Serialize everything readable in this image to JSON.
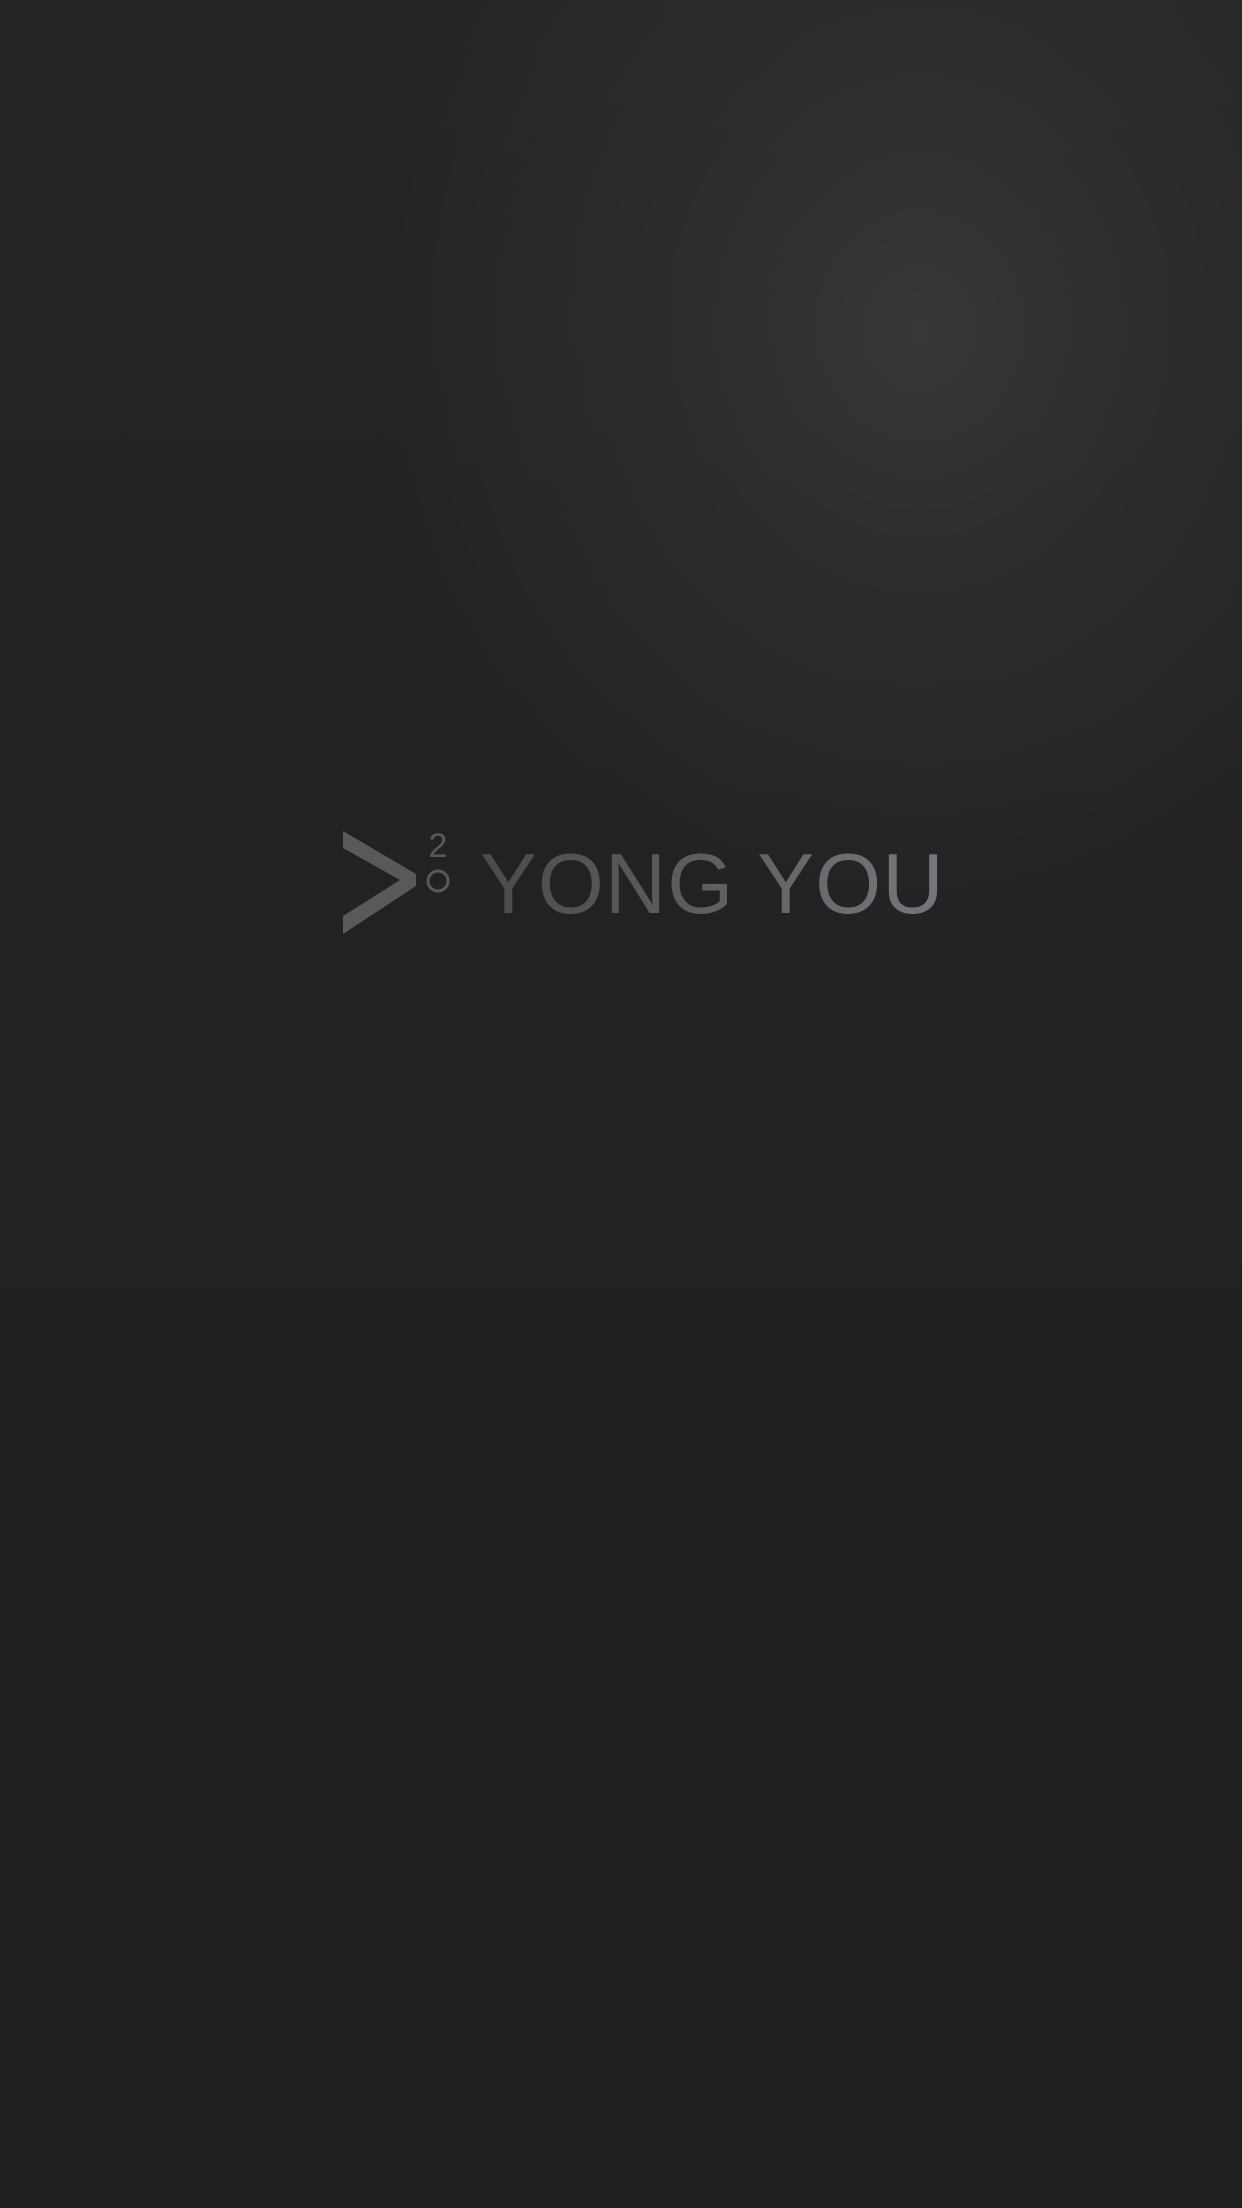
{
  "splash": {
    "brand_name": "YONG YOU",
    "logo_superscript": "2",
    "logo_icon": "chevron-right-icon",
    "background_color": "#202122",
    "logo_color": "#58595b"
  }
}
